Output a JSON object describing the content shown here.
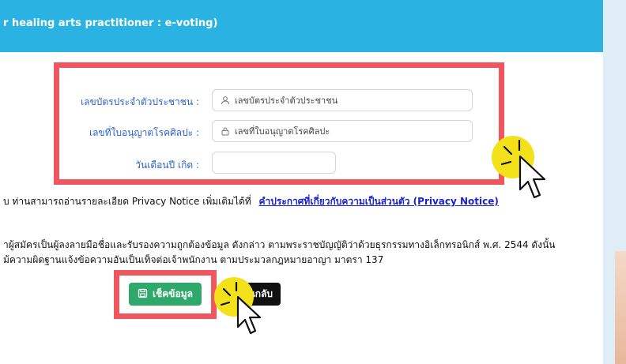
{
  "header": {
    "title": "r healing arts practitioner : e-voting)"
  },
  "form": {
    "id_card": {
      "label": "เลขบัตรประจำตัวประชาชน  :",
      "placeholder": "เลขบัตรประจำตัวประชาชน",
      "icon": "user-icon"
    },
    "license": {
      "label": "เลขที่ใบอนุญาตโรคศิลปะ  :",
      "placeholder": "เลขที่ใบอนุญาตโรคศิลปะ",
      "icon": "lock-icon"
    },
    "birth_date": {
      "label": "วันเดือนปี เกิด  :",
      "value": ""
    }
  },
  "privacy": {
    "text": "บ ท่านสามารถอ่านรายละเอียด Privacy Notice เพิ่มเติมได้ที่",
    "link": "คำประกาศที่เกี่ยวกับความเป็นส่วนตัว (Privacy Notice)"
  },
  "consent": {
    "line1": "าผู้สมัครเป็นผู้ลงลายมือชื่อและรับรองความถูกต้องข้อมูล ดังกล่าว ตามพระราชบัญญัติว่าด้วยธุรกรรมทางอิเล็กทรอนิกส์ พ.ศ. 2544 ดังนั้น",
    "line2": "ม้ความผิดฐานแจ้งข้อความอันเป็นเท็จต่อเจ้าพนักงาน ตามประมวลกฎหมายอาญา มาตรา 137"
  },
  "buttons": {
    "check": {
      "label": "เช็คข้อมูล",
      "icon": "save-icon"
    },
    "back": {
      "label": "นกลับ"
    }
  },
  "colors": {
    "header": "#2ab3e2",
    "highlight": "#f0565e",
    "check_button": "#2ea96b",
    "back_button": "#111111",
    "label": "#2a62c9",
    "cursor_circle": "#f3e21a"
  }
}
